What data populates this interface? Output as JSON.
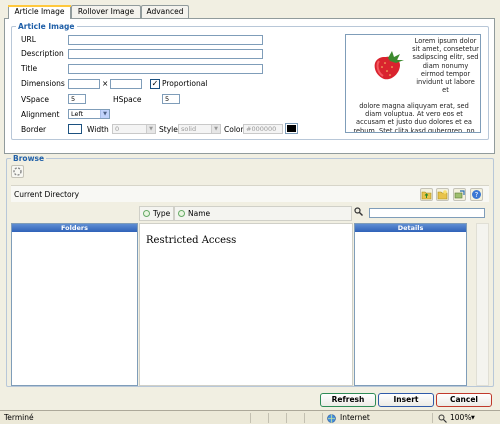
{
  "tabs": [
    {
      "label": "Article Image",
      "active": true
    },
    {
      "label": "Rollover Image",
      "active": false
    },
    {
      "label": "Advanced",
      "active": false
    }
  ],
  "article_image": {
    "legend": "Article Image",
    "url_label": "URL",
    "url_value": "",
    "description_label": "Description",
    "description_value": "",
    "title_label": "Title",
    "title_value": "",
    "dimensions_label": "Dimensions",
    "dimensions_separator": "×",
    "width_value": "",
    "height_value": "",
    "proportional_label": "Proportional",
    "proportional_checked": true,
    "vspace_label": "VSpace",
    "vspace_value": "5",
    "hspace_label": "HSpace",
    "hspace_value": "5",
    "alignment_label": "Alignment",
    "alignment_value": "Left",
    "border_label": "Border",
    "border_checked": false,
    "border_width_label": "Width",
    "border_width_value": "0",
    "border_style_label": "Style",
    "border_style_value": "solid",
    "border_color_label": "Color",
    "border_color_value": "#000000",
    "swatch_color": "#000000",
    "preview_text_right": "Lorem ipsum dolor sit amet, consetetur sadipscing elitr, sed diam nonumy eirmod tempor invidunt ut labore et",
    "preview_text_full": "dolore magna aliquyam erat, sed diam voluptua. At vero eos et accusam et justo duo dolores et ea rebum. Stet clita kasd gubergren, no"
  },
  "browse": {
    "legend": "Browse",
    "current_directory_label": "Current Directory",
    "type_label": "Type",
    "name_label": "Name",
    "search_value": "",
    "folders_label": "Folders",
    "details_label": "Details",
    "message": "Restricted Access"
  },
  "buttons": {
    "refresh": "Refresh",
    "insert": "Insert",
    "cancel": "Cancel"
  },
  "statusbar": {
    "status_text": "Terminé",
    "zone_label": "Internet",
    "zoom_label": "100%"
  },
  "colors": {
    "accent_blue": "#1f5fa8",
    "refresh_border": "#2e8b57",
    "insert_border": "#2f5aa8",
    "cancel_border": "#c0392b"
  }
}
